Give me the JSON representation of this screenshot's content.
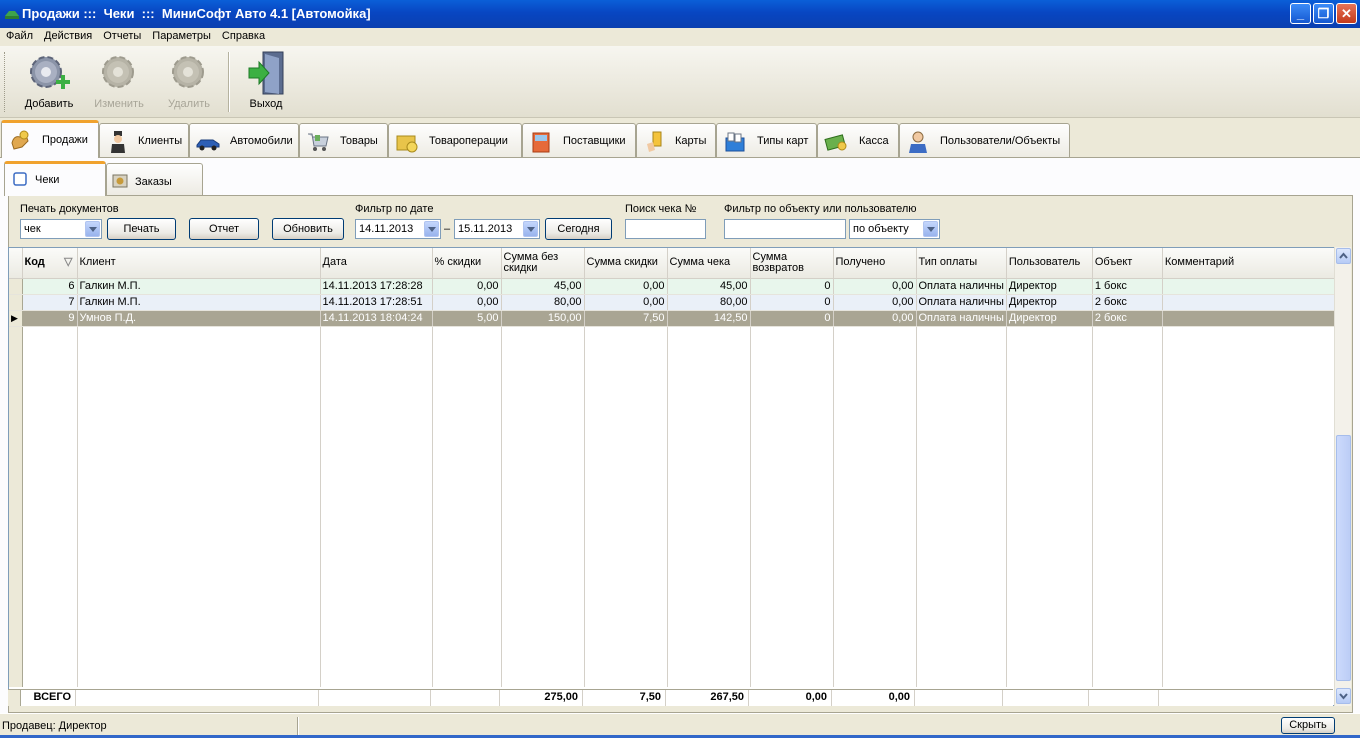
{
  "window": {
    "title": "Продажи :::  Чеки  :::  МиниСофт Авто 4.1 [Автомойка]"
  },
  "menu": [
    "Файл",
    "Действия",
    "Отчеты",
    "Параметры",
    "Справка"
  ],
  "toolbar": {
    "add": "Добавить",
    "edit": "Изменить",
    "delete": "Удалить",
    "exit": "Выход"
  },
  "main_tabs": [
    "Продажи",
    "Клиенты",
    "Автомобили",
    "Товары",
    "Товароперации",
    "Поставщики",
    "Карты",
    "Типы карт",
    "Касса",
    "Пользователи/Объекты"
  ],
  "sub_tabs": [
    "Чеки",
    "Заказы"
  ],
  "filters": {
    "print_label": "Печать документов",
    "print_type": "чек",
    "print_button": "Печать",
    "report_button": "Отчет",
    "refresh_button": "Обновить",
    "date_label": "Фильтр по дате",
    "date_from": "14.11.2013",
    "date_dash": "–",
    "date_to": "15.11.2013",
    "today_button": "Сегодня",
    "search_label": "Поиск чека №",
    "search_value": "",
    "object_label": "Фильтр по объекту или пользователю",
    "object_value": "",
    "object_mode": "по объекту"
  },
  "table": {
    "columns": [
      "Код",
      "Клиент",
      "Дата",
      "% скидки",
      "Сумма без скидки",
      "Сумма скидки",
      "Сумма чека",
      "Сумма возвратов",
      "Получено",
      "Тип оплаты",
      "Пользователь",
      "Объект",
      "Комментарий"
    ],
    "rows": [
      {
        "code": "6",
        "client": "Галкин М.П.",
        "date": "14.11.2013 17:28:28",
        "discount_pct": "0,00",
        "sum_no_discount": "45,00",
        "discount_sum": "0,00",
        "check_sum": "45,00",
        "returns": "0",
        "received": "0,00",
        "payment": "Оплата наличны",
        "user": "Директор",
        "object": "1 бокс",
        "comment": ""
      },
      {
        "code": "7",
        "client": "Галкин М.П.",
        "date": "14.11.2013 17:28:51",
        "discount_pct": "0,00",
        "sum_no_discount": "80,00",
        "discount_sum": "0,00",
        "check_sum": "80,00",
        "returns": "0",
        "received": "0,00",
        "payment": "Оплата наличны",
        "user": "Директор",
        "object": "2 бокс",
        "comment": ""
      },
      {
        "code": "9",
        "client": "Умнов П.Д.",
        "date": "14.11.2013 18:04:24",
        "discount_pct": "5,00",
        "sum_no_discount": "150,00",
        "discount_sum": "7,50",
        "check_sum": "142,50",
        "returns": "0",
        "received": "0,00",
        "payment": "Оплата наличны",
        "user": "Директор",
        "object": "2 бокс",
        "comment": ""
      }
    ],
    "totals": {
      "label": "ВСЕГО",
      "sum_no_discount": "275,00",
      "discount_sum": "7,50",
      "check_sum": "267,50",
      "returns": "0,00",
      "received": "0,00"
    }
  },
  "status": {
    "seller": "Продавец: Директор",
    "hide_button": "Скрыть"
  }
}
